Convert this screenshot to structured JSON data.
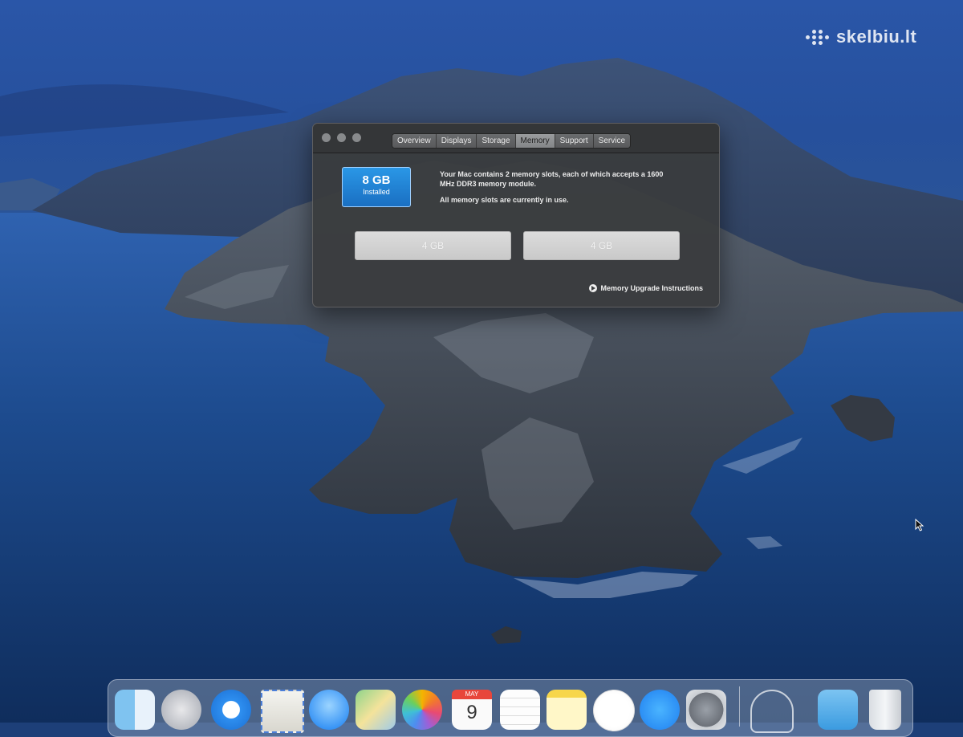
{
  "watermark": {
    "text": "skelbiu.lt"
  },
  "window": {
    "tabs": [
      {
        "label": "Overview",
        "active": false
      },
      {
        "label": "Displays",
        "active": false
      },
      {
        "label": "Storage",
        "active": false
      },
      {
        "label": "Memory",
        "active": true
      },
      {
        "label": "Support",
        "active": false
      },
      {
        "label": "Service",
        "active": false
      }
    ],
    "installed": {
      "amount": "8 GB",
      "label": "Installed"
    },
    "description_line1": "Your Mac contains 2 memory slots, each of which accepts a 1600 MHz DDR3 memory module.",
    "description_line2": "All memory slots are currently in use.",
    "slots": [
      {
        "size": "4 GB"
      },
      {
        "size": "4 GB"
      }
    ],
    "upgrade_link": "Memory Upgrade Instructions"
  },
  "dock": {
    "items": [
      "finder-icon",
      "launchpad-icon",
      "safari-icon",
      "mail-icon",
      "messages-icon",
      "maps-icon",
      "photos-icon",
      "calendar-icon",
      "reminders-icon",
      "notes-icon",
      "music-icon",
      "app-store-icon",
      "system-preferences-icon",
      "utility-icon",
      "downloads-folder-icon",
      "trash-icon"
    ],
    "calendar": {
      "month": "MAY",
      "day": "9"
    }
  },
  "colors": {
    "sky": "#2a56a8",
    "sea": "#123567",
    "installed_badge": "#1f82d6",
    "window_bg": "#3a3c3e"
  }
}
